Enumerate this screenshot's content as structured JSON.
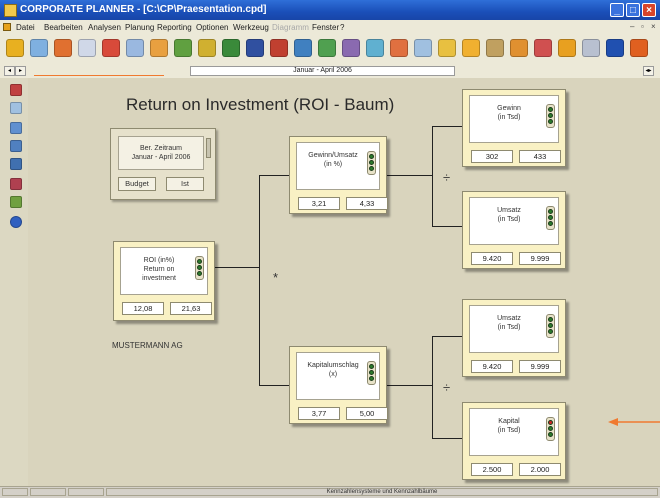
{
  "window": {
    "title": "CORPORATE PLANNER - [C:\\CP\\Praesentation.cpd]",
    "controls": [
      "_",
      "□",
      "×"
    ]
  },
  "menu": [
    "Datei",
    "Bearbeiten",
    "Analysen",
    "Planung",
    "Reporting",
    "Optionen",
    "Werkzeug",
    "Diagramm",
    "Fenster",
    "?"
  ],
  "menu_disabled": "Diagramm",
  "range": {
    "value": "Januar - April 2006"
  },
  "diagram": {
    "title": "Return on Investment (ROI - Baum)",
    "company": "MUSTERMANN AG",
    "period": {
      "label_line1": "Ber. Zeitraum",
      "label_line2": "Januar - April 2006",
      "budget": "Budget",
      "actual": "Ist"
    },
    "operators": {
      "multiply": "*",
      "divide_top": "÷",
      "divide_bottom": "÷"
    },
    "nodes": {
      "roi": {
        "line1": "ROI (in%)",
        "line2": "Return on",
        "line3": "investment",
        "v1": "12,08",
        "v2": "21,63"
      },
      "gewinn_umsatz": {
        "line1": "Gewinn/Umsatz",
        "line2": "(in %)",
        "v1": "3,21",
        "v2": "4,33"
      },
      "kapitalumschlag": {
        "line1": "Kapitalumschlag",
        "line2": "(x)",
        "v1": "3,77",
        "v2": "5,00"
      },
      "gewinn": {
        "line1": "Gewinn",
        "line2": "(in Tsd)",
        "v1": "302",
        "v2": "433"
      },
      "umsatz_top": {
        "line1": "Umsatz",
        "line2": "(in Tsd)",
        "v1": "9.420",
        "v2": "9.999"
      },
      "umsatz_bottom": {
        "line1": "Umsatz",
        "line2": "(in Tsd)",
        "v1": "9.420",
        "v2": "9.999"
      },
      "kapital": {
        "line1": "Kapital",
        "line2": "(in Tsd)",
        "v1": "2.500",
        "v2": "2.000"
      }
    }
  },
  "status": {
    "center": "Kennzahlensysteme und Kennzahlbäume"
  },
  "colors": {
    "accent_arrow": "#f07a30",
    "node_bg": "#f9f1c4",
    "titlebar": "#1a4fb8"
  }
}
